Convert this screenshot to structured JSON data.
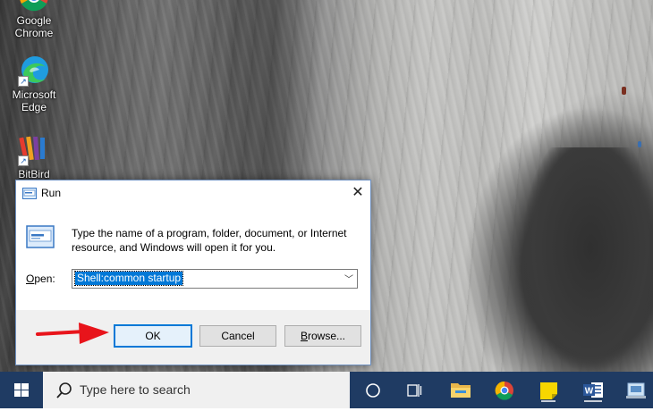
{
  "desktop": {
    "icons": [
      {
        "label_line1": "Google",
        "label_line2": "Chrome",
        "icon": "chrome-icon"
      },
      {
        "label_line1": "Microsoft",
        "label_line2": "Edge",
        "icon": "edge-icon"
      },
      {
        "label_line1": "BitBird",
        "label_line2": "",
        "icon": "app-shortcut-icon"
      }
    ]
  },
  "run_dialog": {
    "title": "Run",
    "description": "Type the name of a program, folder, document, or Internet resource, and Windows will open it for you.",
    "open_label_underlined": "O",
    "open_label_rest": "pen:",
    "open_value": "Shell:common startup",
    "buttons": {
      "ok": "OK",
      "cancel": "Cancel",
      "browse_underlined": "B",
      "browse_rest": "rowse..."
    }
  },
  "taskbar": {
    "search_placeholder": "Type here to search",
    "items": [
      "cortana-icon",
      "task-view-icon",
      "file-explorer-icon",
      "chrome-icon",
      "sticky-notes-icon",
      "word-icon",
      "app-icon"
    ]
  },
  "colors": {
    "taskbar": "#1f3b63",
    "accent": "#0078d7",
    "annotation_arrow": "#e8141b"
  }
}
